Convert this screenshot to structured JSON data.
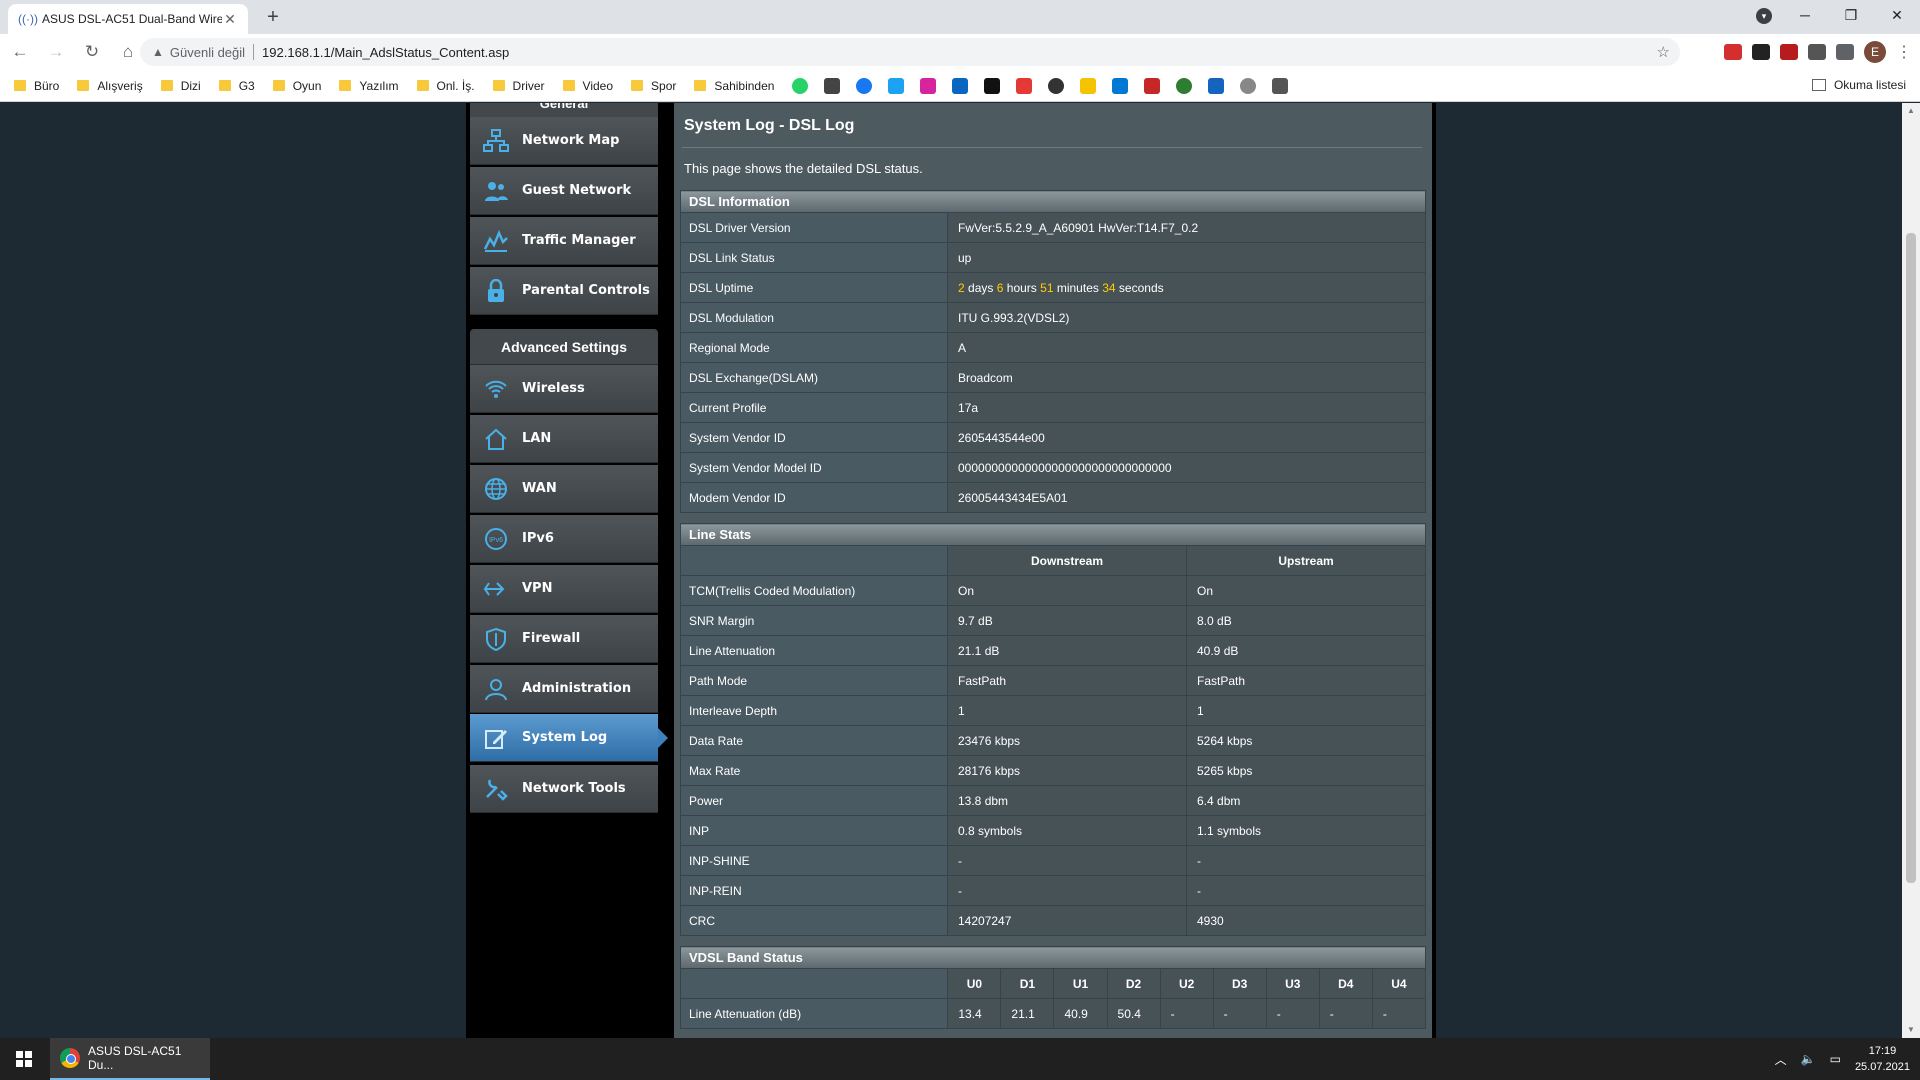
{
  "browser": {
    "tab_title": "ASUS DSL-AC51 Dual-Band Wire",
    "security_label": "Güvenli değil",
    "url": "192.168.1.1/Main_AdslStatus_Content.asp",
    "profile_initial": "E",
    "bookmarks": [
      "Büro",
      "Alışveriş",
      "Dizi",
      "G3",
      "Oyun",
      "Yazılım",
      "Onl. İş.",
      "Driver",
      "Video",
      "Spor",
      "Sahibinden"
    ],
    "reading_list": "Okuma listesi"
  },
  "sidebar": {
    "top_label": "General",
    "general_items": [
      {
        "label": "Network Map",
        "icon": "network-map-icon"
      },
      {
        "label": "Guest Network",
        "icon": "guest-network-icon"
      },
      {
        "label": "Traffic Manager",
        "icon": "traffic-manager-icon"
      },
      {
        "label": "Parental Controls",
        "icon": "lock-icon"
      }
    ],
    "advanced_header": "Advanced Settings",
    "advanced_items": [
      {
        "label": "Wireless",
        "icon": "wifi-icon"
      },
      {
        "label": "LAN",
        "icon": "home-icon"
      },
      {
        "label": "WAN",
        "icon": "globe-icon"
      },
      {
        "label": "IPv6",
        "icon": "ipv6-icon"
      },
      {
        "label": "VPN",
        "icon": "vpn-icon"
      },
      {
        "label": "Firewall",
        "icon": "shield-icon"
      },
      {
        "label": "Administration",
        "icon": "user-icon"
      },
      {
        "label": "System Log",
        "icon": "edit-icon",
        "active": true
      },
      {
        "label": "Network Tools",
        "icon": "tools-icon"
      }
    ]
  },
  "main": {
    "title": "System Log - DSL Log",
    "description": "This page shows the detailed DSL status.",
    "dsl_info": {
      "header": "DSL Information",
      "rows": [
        {
          "key": "DSL Driver Version",
          "value": "FwVer:5.5.2.9_A_A60901 HwVer:T14.F7_0.2"
        },
        {
          "key": "DSL Link Status",
          "value": "up"
        },
        {
          "key": "DSL Uptime",
          "value": ""
        },
        {
          "key": "DSL Modulation",
          "value": "ITU G.993.2(VDSL2)"
        },
        {
          "key": "Regional Mode",
          "value": "A"
        },
        {
          "key": "DSL Exchange(DSLAM)",
          "value": "Broadcom"
        },
        {
          "key": "Current Profile",
          "value": "17a"
        },
        {
          "key": "System Vendor ID",
          "value": "2605443544e00"
        },
        {
          "key": "System Vendor Model ID",
          "value": "00000000000000000000000000000000"
        },
        {
          "key": "Modem Vendor ID",
          "value": "26005443434E5A01"
        }
      ],
      "uptime": {
        "days": "2",
        "days_label": "days",
        "hours": "6",
        "hours_label": "hours",
        "minutes": "51",
        "minutes_label": "minutes",
        "seconds": "34",
        "seconds_label": "seconds"
      }
    },
    "line_stats": {
      "header": "Line Stats",
      "columns": [
        "Downstream",
        "Upstream"
      ],
      "rows": [
        {
          "key": "TCM(Trellis Coded Modulation)",
          "down": "On",
          "up": "On"
        },
        {
          "key": "SNR Margin",
          "down": "9.7 dB",
          "up": "8.0 dB"
        },
        {
          "key": "Line Attenuation",
          "down": "21.1 dB",
          "up": "40.9 dB"
        },
        {
          "key": "Path Mode",
          "down": "FastPath",
          "up": "FastPath"
        },
        {
          "key": "Interleave Depth",
          "down": "1",
          "up": "1"
        },
        {
          "key": "Data Rate",
          "down": "23476 kbps",
          "up": "5264 kbps"
        },
        {
          "key": "Max Rate",
          "down": "28176 kbps",
          "up": "5265 kbps"
        },
        {
          "key": "Power",
          "down": "13.8 dbm",
          "up": "6.4 dbm"
        },
        {
          "key": "INP",
          "down": "0.8 symbols",
          "up": "1.1 symbols"
        },
        {
          "key": "INP-SHINE",
          "down": "-",
          "up": "-"
        },
        {
          "key": "INP-REIN",
          "down": "-",
          "up": "-"
        },
        {
          "key": "CRC",
          "down": "14207247",
          "up": "4930"
        }
      ]
    },
    "vdsl_band": {
      "header": "VDSL Band Status",
      "bands": [
        "U0",
        "D1",
        "U1",
        "D2",
        "U2",
        "D3",
        "U3",
        "D4",
        "U4"
      ],
      "rows": [
        {
          "key": "Line Attenuation (dB)",
          "values": [
            "13.4",
            "21.1",
            "40.9",
            "50.4",
            "-",
            "-",
            "-",
            "-",
            "-"
          ]
        }
      ]
    }
  },
  "taskbar": {
    "app_label": "ASUS DSL-AC51 Du...",
    "time": "17:19",
    "date": "25.07.2021"
  },
  "colors": {
    "highlight_yellow": "#ffcc00",
    "upstream_blue": "#4ab0e8",
    "downstream_orange": "#f0a040",
    "active_menu": "#3e80bc"
  }
}
